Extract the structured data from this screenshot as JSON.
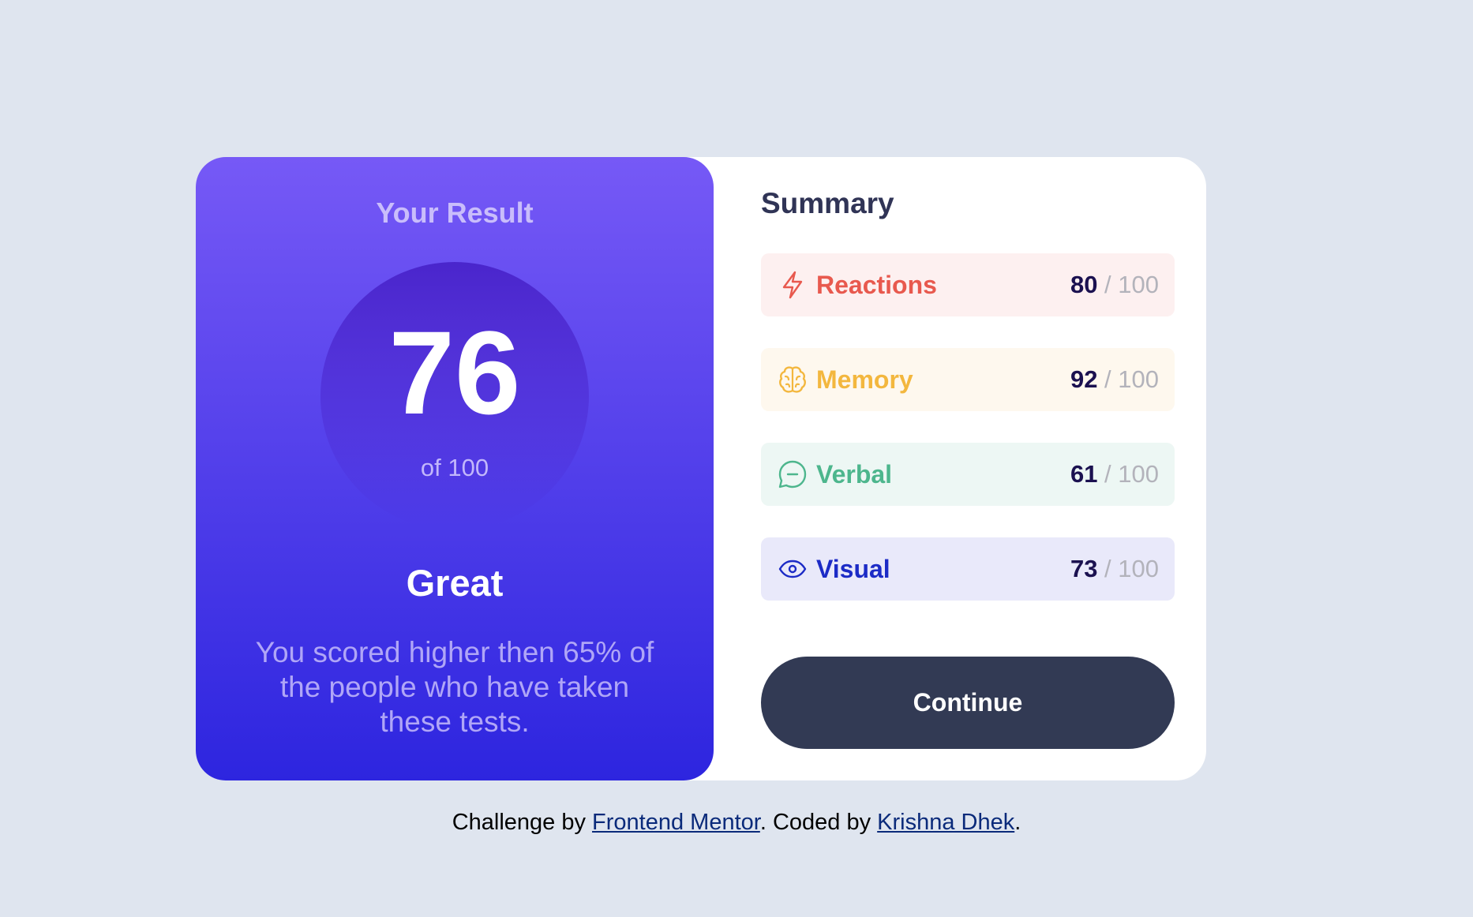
{
  "result": {
    "title": "Your Result",
    "score": "76",
    "score_of": "of 100",
    "rating": "Great",
    "description": "You scored higher then 65% of the people who have taken these tests."
  },
  "summary": {
    "title": "Summary",
    "items": [
      {
        "label": "Reactions",
        "score": "80",
        "max": " / 100",
        "icon": "lightning-icon",
        "color": "#e8594e",
        "bg": "#fdf0f0"
      },
      {
        "label": "Memory",
        "score": "92",
        "max": " / 100",
        "icon": "brain-icon",
        "color": "#f3b73e",
        "bg": "#fef8ee"
      },
      {
        "label": "Verbal",
        "score": "61",
        "max": " / 100",
        "icon": "chat-bubble-icon",
        "color": "#4db68d",
        "bg": "#edf7f4"
      },
      {
        "label": "Visual",
        "score": "73",
        "max": " / 100",
        "icon": "eye-icon",
        "color": "#1c2bc6",
        "bg": "#e9e9fa"
      }
    ],
    "continue_label": "Continue"
  },
  "footer": {
    "prefix": "Challenge by ",
    "link1": "Frontend Mentor",
    "middle": ". Coded by ",
    "link2": "Krishna Dhek",
    "suffix": "."
  }
}
